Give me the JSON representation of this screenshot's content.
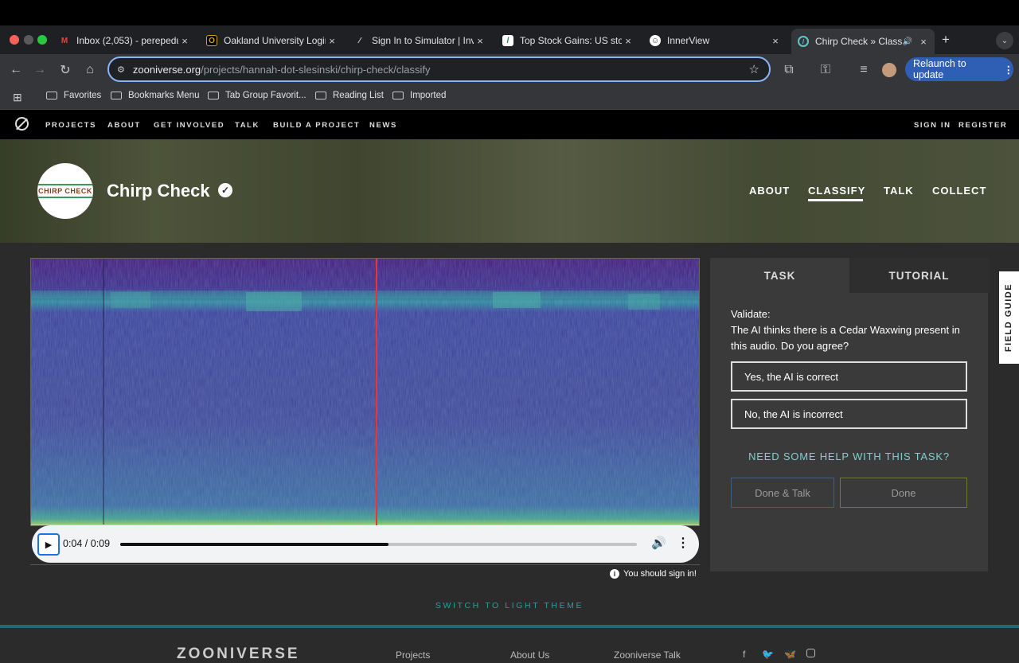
{
  "browser": {
    "tabs": [
      {
        "title": "Inbox (2,053) - perepedu",
        "icon": "gmail-icon",
        "close": "×"
      },
      {
        "title": "Oakland University Login",
        "icon": "oakland-icon",
        "close": "×"
      },
      {
        "title": "Sign In to Simulator | Inve",
        "icon": "simulator-icon",
        "close": "×"
      },
      {
        "title": "Top Stock Gains: US stoc",
        "icon": "stock-icon",
        "close": "×"
      },
      {
        "title": "InnerView",
        "icon": "innerview-icon",
        "close": "×"
      },
      {
        "title": "Chirp Check » Classi",
        "icon": "zooniverse-icon",
        "close": "×",
        "audio": "🔊"
      }
    ],
    "new_tab": "+",
    "url_domain": "zooniverse.org",
    "url_path": "/projects/hannah-dot-slesinski/chirp-check/classify",
    "relaunch_label": "Relaunch to update",
    "bookmarks": [
      "Favorites",
      "Bookmarks Menu",
      "Tab Group Favorit...",
      "Reading List",
      "Imported"
    ]
  },
  "zooniverse_nav": {
    "items": [
      "PROJECTS",
      "ABOUT",
      "GET INVOLVED",
      "TALK",
      "BUILD A PROJECT",
      "NEWS"
    ],
    "sign_in": "SIGN IN",
    "register": "REGISTER"
  },
  "project": {
    "title": "Chirp Check",
    "logo_text": "CHIRP CHECK",
    "verified_icon": "✓",
    "nav": [
      "ABOUT",
      "CLASSIFY",
      "TALK",
      "COLLECT"
    ],
    "active_nav": "CLASSIFY"
  },
  "player": {
    "time": "0:04 / 0:09",
    "progress": 0.52
  },
  "sign_in_note": "You should sign in!",
  "task": {
    "tabs": [
      "TASK",
      "TUTORIAL"
    ],
    "question_label": "Validate:",
    "question": "The AI thinks there is a Cedar Waxwing present in this audio. Do you agree?",
    "answers": [
      "Yes, the AI is correct",
      "No, the AI is incorrect"
    ],
    "help": "NEED SOME HELP WITH THIS TASK?",
    "done_talk": "Done & Talk",
    "done": "Done"
  },
  "field_guide": "FIELD GUIDE",
  "theme_switch": "SWITCH TO LIGHT THEME",
  "footer": {
    "logo": "ZOONIVERSE",
    "links": [
      "Projects",
      "About Us",
      "Zooniverse Talk"
    ],
    "social": [
      "f",
      "t",
      "b",
      "ig"
    ]
  },
  "colors": {
    "accent_teal": "#2a9d9d",
    "link_blue": "#8ab4f8",
    "relaunch": "#2f5fb5",
    "spectro_low": "#3b1f6e",
    "spectro_high": "#3fc08a"
  }
}
